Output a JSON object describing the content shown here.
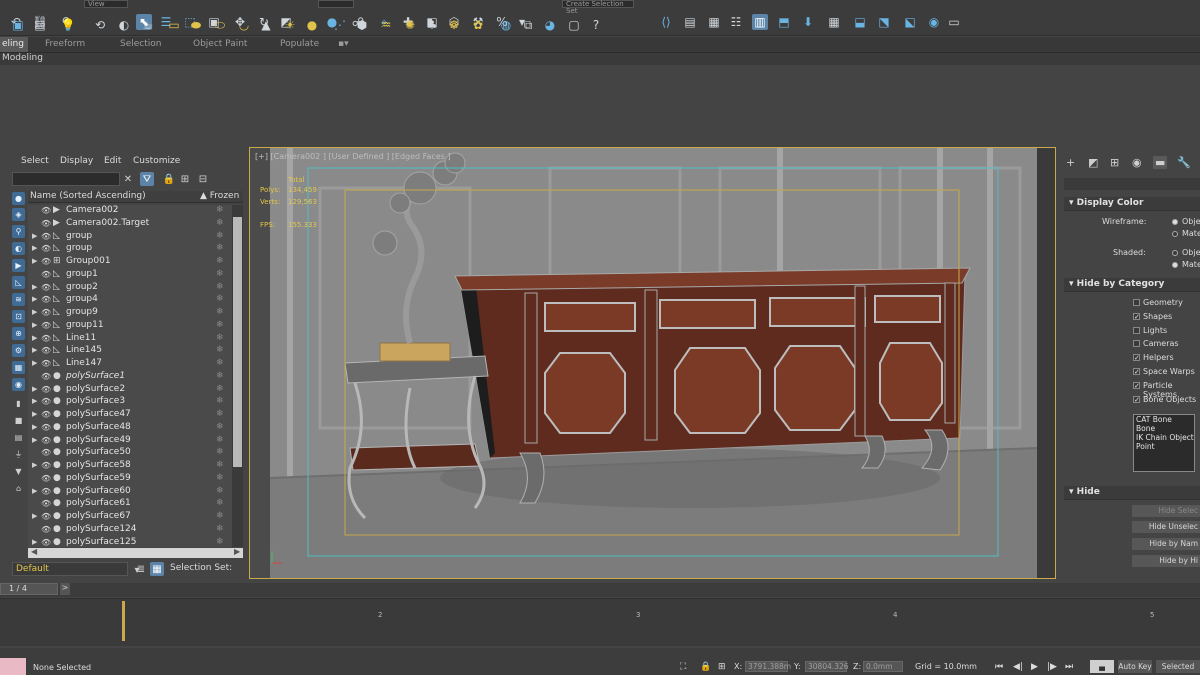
{
  "toolbar": {
    "dropdown_view": "View",
    "dropdown_selection_set": "Create Selection Set"
  },
  "ribbon": {
    "tabs": [
      "eling",
      "Freeform",
      "Selection",
      "Object Paint",
      "Populate"
    ],
    "panel_label": "Modeling"
  },
  "explorer": {
    "menu": [
      "Select",
      "Display",
      "Edit",
      "Customize"
    ],
    "col_name": "Name (Sorted Ascending)",
    "col_frozen": "▲ Frozen",
    "rows": [
      {
        "name": "Camera002",
        "icon": "camera-icon",
        "expand": false,
        "italic": false
      },
      {
        "name": "Camera002.Target",
        "icon": "camera-icon",
        "expand": false,
        "italic": false
      },
      {
        "name": "group",
        "icon": "shape-icon",
        "expand": true,
        "italic": false
      },
      {
        "name": "group",
        "icon": "shape-icon",
        "expand": true,
        "italic": false
      },
      {
        "name": "Group001",
        "icon": "group-icon",
        "expand": true,
        "italic": false
      },
      {
        "name": "group1",
        "icon": "shape-icon",
        "expand": false,
        "italic": false
      },
      {
        "name": "group2",
        "icon": "shape-icon",
        "expand": true,
        "italic": false
      },
      {
        "name": "group4",
        "icon": "shape-icon",
        "expand": true,
        "italic": false
      },
      {
        "name": "group9",
        "icon": "shape-icon",
        "expand": true,
        "italic": false
      },
      {
        "name": "group11",
        "icon": "shape-icon",
        "expand": true,
        "italic": false
      },
      {
        "name": "Line11",
        "icon": "shape-icon",
        "expand": true,
        "italic": false
      },
      {
        "name": "Line145",
        "icon": "shape-icon",
        "expand": true,
        "italic": false
      },
      {
        "name": "Line147",
        "icon": "shape-icon",
        "expand": true,
        "italic": false
      },
      {
        "name": "polySurface1",
        "icon": "sphere-icon",
        "expand": false,
        "italic": true
      },
      {
        "name": "polySurface2",
        "icon": "sphere-icon",
        "expand": true,
        "italic": false
      },
      {
        "name": "polySurface3",
        "icon": "sphere-icon",
        "expand": true,
        "italic": false
      },
      {
        "name": "polySurface47",
        "icon": "sphere-icon",
        "expand": true,
        "italic": false
      },
      {
        "name": "polySurface48",
        "icon": "sphere-icon",
        "expand": true,
        "italic": false
      },
      {
        "name": "polySurface49",
        "icon": "sphere-icon",
        "expand": true,
        "italic": false
      },
      {
        "name": "polySurface50",
        "icon": "sphere-icon",
        "expand": false,
        "italic": false
      },
      {
        "name": "polySurface58",
        "icon": "sphere-icon",
        "expand": true,
        "italic": false
      },
      {
        "name": "polySurface59",
        "icon": "sphere-icon",
        "expand": false,
        "italic": false
      },
      {
        "name": "polySurface60",
        "icon": "sphere-icon",
        "expand": true,
        "italic": false
      },
      {
        "name": "polySurface61",
        "icon": "sphere-icon",
        "expand": false,
        "italic": false
      },
      {
        "name": "polySurface67",
        "icon": "sphere-icon",
        "expand": true,
        "italic": false
      },
      {
        "name": "polySurface124",
        "icon": "sphere-icon",
        "expand": false,
        "italic": false
      },
      {
        "name": "polySurface125",
        "icon": "sphere-icon",
        "expand": true,
        "italic": false
      }
    ],
    "layer": "Default",
    "selection_set_label": "Selection Set:"
  },
  "viewport": {
    "label": "[+] [Camera002 ] [User Defined ] [Edged Faces ]",
    "stats_total": "Total",
    "polys_label": "Polys:",
    "polys_value": "134,459",
    "verts_label": "Verts:",
    "verts_value": "129,563",
    "fps_label": "FPS:",
    "fps_value": "155.333"
  },
  "command_panel": {
    "display_color": "Display Color",
    "wireframe": "Wireframe:",
    "shaded": "Shaded:",
    "radio_obj": "Obje",
    "radio_mat": "Mate",
    "hide_by_category": "Hide by Category",
    "categories": [
      {
        "label": "Geometry",
        "checked": false
      },
      {
        "label": "Shapes",
        "checked": true
      },
      {
        "label": "Lights",
        "checked": false
      },
      {
        "label": "Cameras",
        "checked": false
      },
      {
        "label": "Helpers",
        "checked": true
      },
      {
        "label": "Space Warps",
        "checked": true
      },
      {
        "label": "Particle Systems",
        "checked": true
      },
      {
        "label": "Bone Objects",
        "checked": true
      }
    ],
    "category_list": [
      "CAT Bone",
      "Bone",
      "IK Chain Object",
      "Point"
    ],
    "hide": "Hide",
    "hide_buttons": [
      "Hide Selec",
      "Hide Unselec",
      "Hide by Nam",
      "Hide by Hi"
    ]
  },
  "bottom": {
    "frame": "1 / 4",
    "ticks": [
      "2",
      "3",
      "4",
      "5"
    ],
    "status": "None Selected",
    "x_label": "X:",
    "x_value": "3791.388m",
    "y_label": "Y:",
    "y_value": "30804.326",
    "z_label": "Z:",
    "z_value": "0.0mm",
    "grid": "Grid = 10.0mm",
    "auto_key": "Auto Key",
    "selected": "Selected"
  }
}
